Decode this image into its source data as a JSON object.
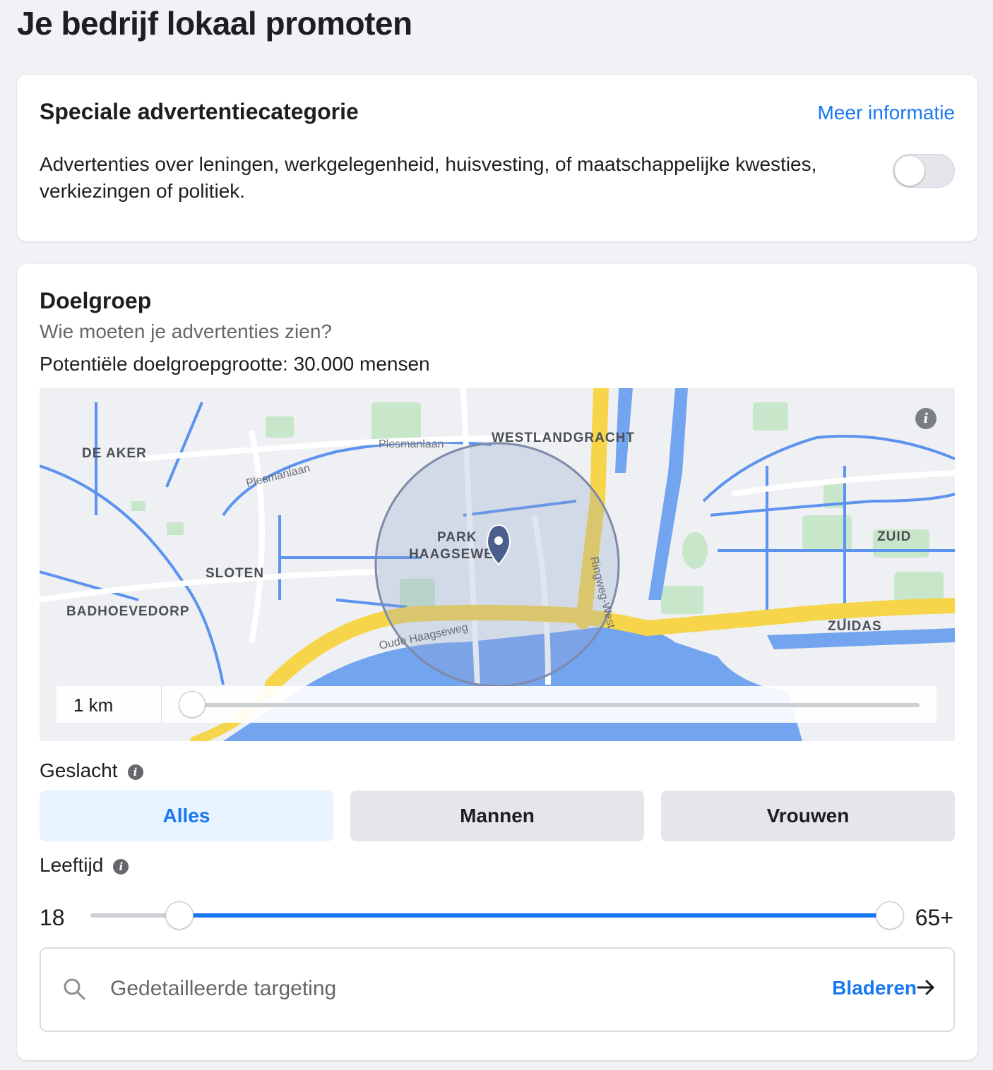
{
  "page": {
    "title": "Je bedrijf lokaal promoten"
  },
  "special_category": {
    "title": "Speciale advertentiecategorie",
    "more_info": "Meer informatie",
    "description": "Advertenties over leningen, werkgelegenheid, huisvesting, of maatschappelijke kwesties, verkiezingen of politiek.",
    "toggle_on": false
  },
  "audience": {
    "title": "Doelgroep",
    "subtitle": "Wie moeten je advertenties zien?",
    "size_text": "Potentiële doelgroepgrootte: 30.000 mensen",
    "map": {
      "labels": {
        "de_aker": "DE AKER",
        "sloten": "SLOTEN",
        "badhoevedorp": "BADHOEVEDORP",
        "westlandgracht": "WESTLANDGRACHT",
        "park": "PARK",
        "haagseweg_area": "HAAGSEWEG",
        "zuid": "ZUID",
        "zuidas": "ZUIDAS",
        "plesmanlaan_1": "Plesmanlaan",
        "plesmanlaan_2": "Plesmanlaan",
        "ringweg_west": "Ringweg-West",
        "oude_haagseweg": "Oude Haagseweg"
      },
      "info_icon": "info-icon",
      "pin_icon": "map-pin-icon"
    },
    "radius": {
      "label": "1 km",
      "value_km": 1
    },
    "gender": {
      "label": "Geslacht",
      "options": [
        "Alles",
        "Mannen",
        "Vrouwen"
      ],
      "selected": "Alles"
    },
    "age": {
      "label": "Leeftijd",
      "min": "18",
      "max": "65+"
    },
    "targeting": {
      "placeholder": "Gedetailleerde targeting",
      "browse": "Bladeren",
      "search_icon": "search-icon",
      "arrow_icon": "arrow-right-icon"
    }
  },
  "colors": {
    "accent": "#1877f2",
    "water": "#73a4f0",
    "highway": "#f7d54a",
    "park": "#c8e6c9"
  }
}
